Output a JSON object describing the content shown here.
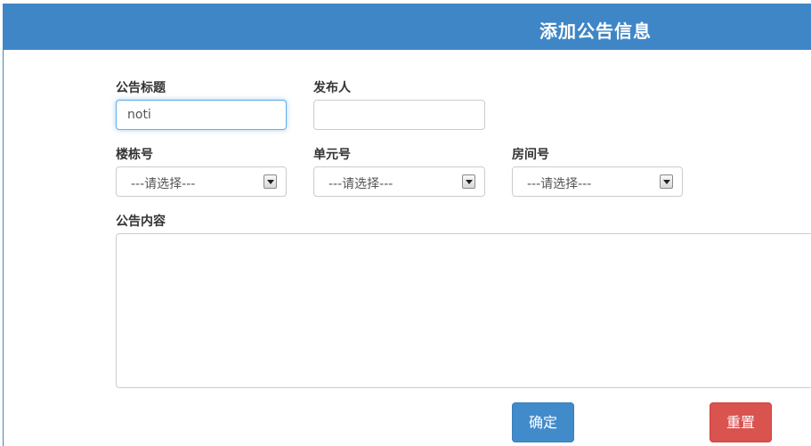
{
  "header": {
    "title": "添加公告信息"
  },
  "form": {
    "title_label": "公告标题",
    "title_value": "noti",
    "publisher_label": "发布人",
    "publisher_value": "",
    "building_label": "楼栋号",
    "building_value": "---请选择---",
    "unit_label": "单元号",
    "unit_value": "---请选择---",
    "room_label": "房间号",
    "room_value": "---请选择---",
    "content_label": "公告内容",
    "content_value": ""
  },
  "buttons": {
    "confirm": "确定",
    "reset": "重置"
  },
  "colors": {
    "header": "#3f86c6",
    "primary": "#428bca",
    "danger": "#d9534f",
    "focus": "#66afe9"
  },
  "icons": {
    "select_arrow": "chevron-down-icon"
  }
}
